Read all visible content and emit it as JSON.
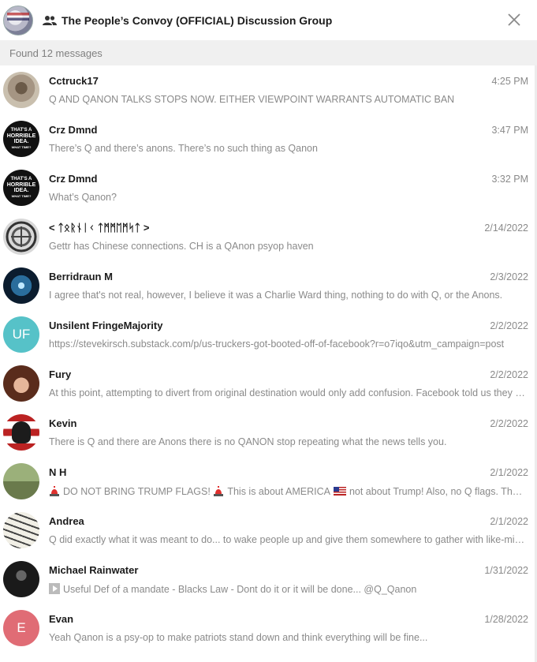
{
  "header": {
    "title": "The People’s Convoy (OFFICIAL) Discussion Group",
    "group_icon": "group-icon",
    "close_icon": "close-icon"
  },
  "search": {
    "found_text": "Found 12 messages"
  },
  "messages": [
    {
      "name": "Cctruck17",
      "time": "4:25 PM",
      "preview": "Q AND QANON TALKS STOPS NOW. EITHER VIEWPOINT WARRANTS AUTOMATIC BAN",
      "avatar": "photo"
    },
    {
      "name": "Crz Dmnd",
      "time": "3:47 PM",
      "preview": "There’s Q and there’s anons. There’s no such thing as Qanon",
      "avatar": "text-badge"
    },
    {
      "name": "Crz Dmnd",
      "time": "3:32 PM",
      "preview": "What’s Qanon?",
      "avatar": "text-badge"
    },
    {
      "name": "< ᛏᛟᚱᚾᛁᚲ ᛏᛗᛗᛖᛗᛋᛏ >",
      "time": "2/14/2022",
      "preview": "Gettr has Chinese connections.  CH is a QAnon psyop haven",
      "avatar": "celtic-knot"
    },
    {
      "name": "Berridraun M",
      "time": "2/3/2022",
      "preview": "I agree that's not real, however, I believe it was a Charlie Ward thing, nothing to do with Q, or the Anons.",
      "avatar": "blue-burst"
    },
    {
      "name": "Unsilent FringeMajority",
      "time": "2/2/2022",
      "preview": "https://stevekirsch.substack.com/p/us-truckers-got-booted-off-of-facebook?r=o7iqo&utm_campaign=post",
      "avatar": "initials",
      "initials": "UF",
      "color": "#56c2c8"
    },
    {
      "name": "Fury",
      "time": "2/2/2022",
      "preview": "At this point, attempting to divert from original destination would only add confusion. Facebook told us they are tracking.",
      "avatar": "portrait"
    },
    {
      "name": "Kevin",
      "time": "2/2/2022",
      "preview": "There is Q and there are Anons there is no QANON stop repeating what the news tells you.",
      "avatar": "skull"
    },
    {
      "name": "N H",
      "time": "2/1/2022",
      "preview_parts": [
        "DO NOT BRING TRUMP FLAGS!",
        "This is about AMERICA",
        "not about Trump! Also, no Q flags. Thanks"
      ],
      "avatar": "outdoor"
    },
    {
      "name": "Andrea",
      "time": "2/1/2022",
      "preview": "Q did exactly what it was meant to do... to wake people up and give them somewhere to gather with like-minded people",
      "avatar": "sign"
    },
    {
      "name": "Michael Rainwater",
      "time": "1/31/2022",
      "preview": "Useful Def of a mandate - Blacks Law - Dont do it or it will be done...  @Q_Qanon",
      "avatar": "dark"
    },
    {
      "name": "Evan",
      "time": "1/28/2022",
      "preview": "Yeah Qanon is a psy-op to make patriots stand down and think everything will be fine...",
      "avatar": "initials",
      "initials": "E",
      "color": "#e06c75"
    }
  ],
  "badge_text": {
    "line1": "THAT'S A",
    "line2": "HORRIBLE",
    "line3": "IDEA.",
    "line4": "WHAT TIME?"
  },
  "colors": {
    "accent_teal": "#56c2c8",
    "accent_red": "#e06c75",
    "found_bar_bg": "#f0f0f0"
  }
}
